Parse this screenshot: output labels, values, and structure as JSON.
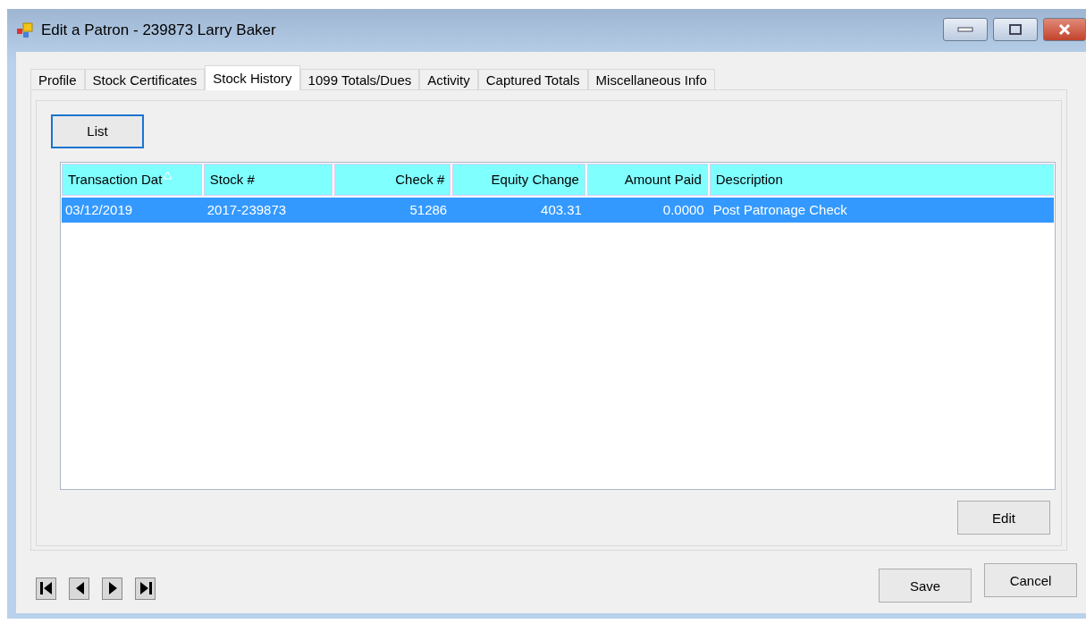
{
  "window": {
    "title": "Edit a Patron - 239873 Larry Baker"
  },
  "tabs": [
    {
      "label": "Profile",
      "selected": false
    },
    {
      "label": "Stock Certificates",
      "selected": false
    },
    {
      "label": "Stock History",
      "selected": true
    },
    {
      "label": "1099 Totals/Dues",
      "selected": false
    },
    {
      "label": "Activity",
      "selected": false
    },
    {
      "label": "Captured Totals",
      "selected": false
    },
    {
      "label": "Miscellaneous Info",
      "selected": false
    }
  ],
  "list_button": "List",
  "table": {
    "columns": [
      {
        "label": "Transaction Dat",
        "sorted": true
      },
      {
        "label": "Stock #",
        "sorted": false
      },
      {
        "label": "Check #",
        "sorted": false
      },
      {
        "label": "Equity Change",
        "sorted": false
      },
      {
        "label": "Amount Paid",
        "sorted": false
      },
      {
        "label": "Description",
        "sorted": false
      }
    ],
    "rows": [
      {
        "selected": true,
        "cells": [
          "03/12/2019",
          "2017-239873",
          "51286",
          "403.31",
          "0.0000",
          "Post Patronage Check"
        ]
      }
    ]
  },
  "edit_button": "Edit",
  "nav_buttons": [
    {
      "kind": "first"
    },
    {
      "kind": "prev"
    },
    {
      "kind": "next"
    },
    {
      "kind": "last"
    }
  ],
  "save_button": "Save",
  "cancel_button": "Cancel"
}
